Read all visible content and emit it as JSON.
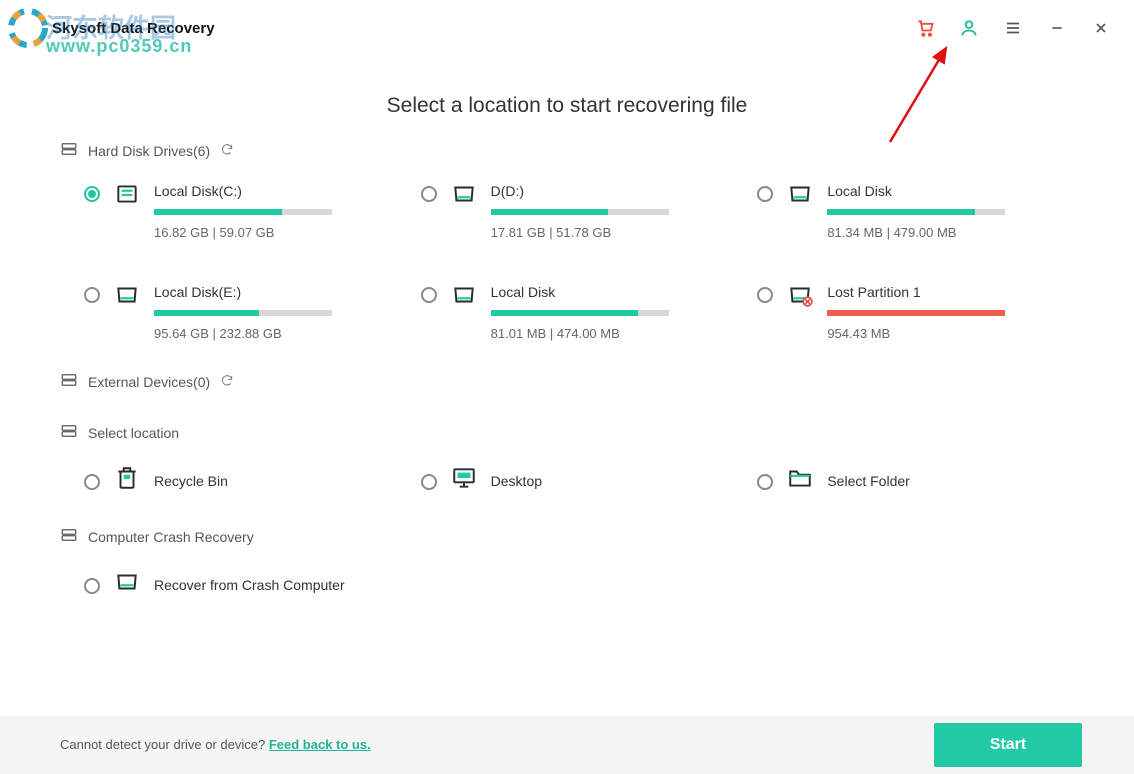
{
  "app": {
    "title": "Skysoft Data Recovery"
  },
  "watermark_url": "www.pc0359.cn",
  "watermark_cn": "河东软件园",
  "page_title": "Select a location to start recovering file",
  "sections": {
    "hard_disk": {
      "label": "Hard Disk Drives(6)"
    },
    "external": {
      "label": "External Devices(0)"
    },
    "select_loc": {
      "label": "Select location"
    },
    "crash": {
      "label": "Computer Crash Recovery"
    }
  },
  "drives": [
    {
      "name": "Local Disk(C:)",
      "capacity": "16.82  GB | 59.07  GB",
      "fill_pct": 72,
      "color": "green",
      "selected": true
    },
    {
      "name": "D(D:)",
      "capacity": "17.81  GB | 51.78  GB",
      "fill_pct": 66,
      "color": "green",
      "selected": false
    },
    {
      "name": "Local Disk",
      "capacity": "81.34  MB | 479.00  MB",
      "fill_pct": 83,
      "color": "green",
      "selected": false
    },
    {
      "name": "Local Disk(E:)",
      "capacity": "95.64  GB | 232.88  GB",
      "fill_pct": 59,
      "color": "green",
      "selected": false
    },
    {
      "name": "Local Disk",
      "capacity": "81.01  MB | 474.00  MB",
      "fill_pct": 83,
      "color": "green",
      "selected": false
    },
    {
      "name": "Lost Partition 1",
      "capacity": "954.43  MB",
      "fill_pct": 100,
      "color": "red",
      "selected": false
    }
  ],
  "locations": [
    {
      "name": "Recycle Bin"
    },
    {
      "name": "Desktop"
    },
    {
      "name": "Select Folder"
    }
  ],
  "crash_item": {
    "name": "Recover from Crash Computer"
  },
  "footer": {
    "text": "Cannot detect your drive or device? ",
    "link": "Feed back to us.",
    "start": "Start"
  },
  "colors": {
    "accent": "#21c9a4",
    "cart": "#e84f3d",
    "user": "#22b99a"
  }
}
